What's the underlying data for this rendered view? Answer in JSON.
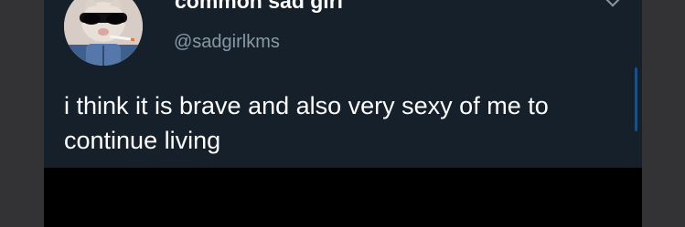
{
  "tweet": {
    "display_name": "common sad girl",
    "handle": "@sadgirlkms",
    "text": "i think it is brave and also very sexy of me to continue living"
  },
  "icons": {
    "avatar": "cat-with-sunglasses-avatar",
    "menu": "chevron-down-icon"
  },
  "colors": {
    "card_background": "#15202b",
    "page_background": "#333335",
    "text_primary": "#ffffff",
    "text_secondary": "#8899a6"
  }
}
